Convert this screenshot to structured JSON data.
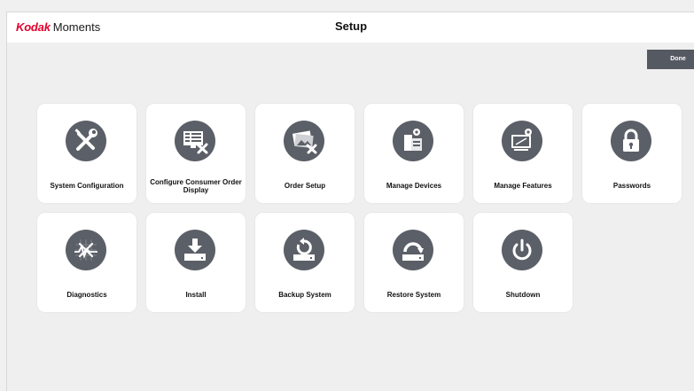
{
  "header": {
    "brand_kodak": "Kodak",
    "brand_moments": "Moments",
    "title": "Setup"
  },
  "actions": {
    "done_label": "Done"
  },
  "tiles": [
    {
      "label": "System Configuration",
      "icon": "wrench-screwdriver-icon"
    },
    {
      "label": "Configure Consumer Order Display",
      "icon": "display-config-icon"
    },
    {
      "label": "Order Setup",
      "icon": "photos-tools-icon"
    },
    {
      "label": "Manage Devices",
      "icon": "devices-gear-icon"
    },
    {
      "label": "Manage Features",
      "icon": "monitor-gear-icon"
    },
    {
      "label": "Passwords",
      "icon": "lock-icon"
    },
    {
      "label": "Diagnostics",
      "icon": "diagnostics-icon"
    },
    {
      "label": "Install",
      "icon": "install-download-icon"
    },
    {
      "label": "Backup System",
      "icon": "backup-icon"
    },
    {
      "label": "Restore System",
      "icon": "restore-icon"
    },
    {
      "label": "Shutdown",
      "icon": "power-icon"
    }
  ],
  "colors": {
    "brand_red": "#e4002b",
    "icon_circle": "#5b5f67",
    "done_button": "#555962",
    "background": "#efefef"
  }
}
